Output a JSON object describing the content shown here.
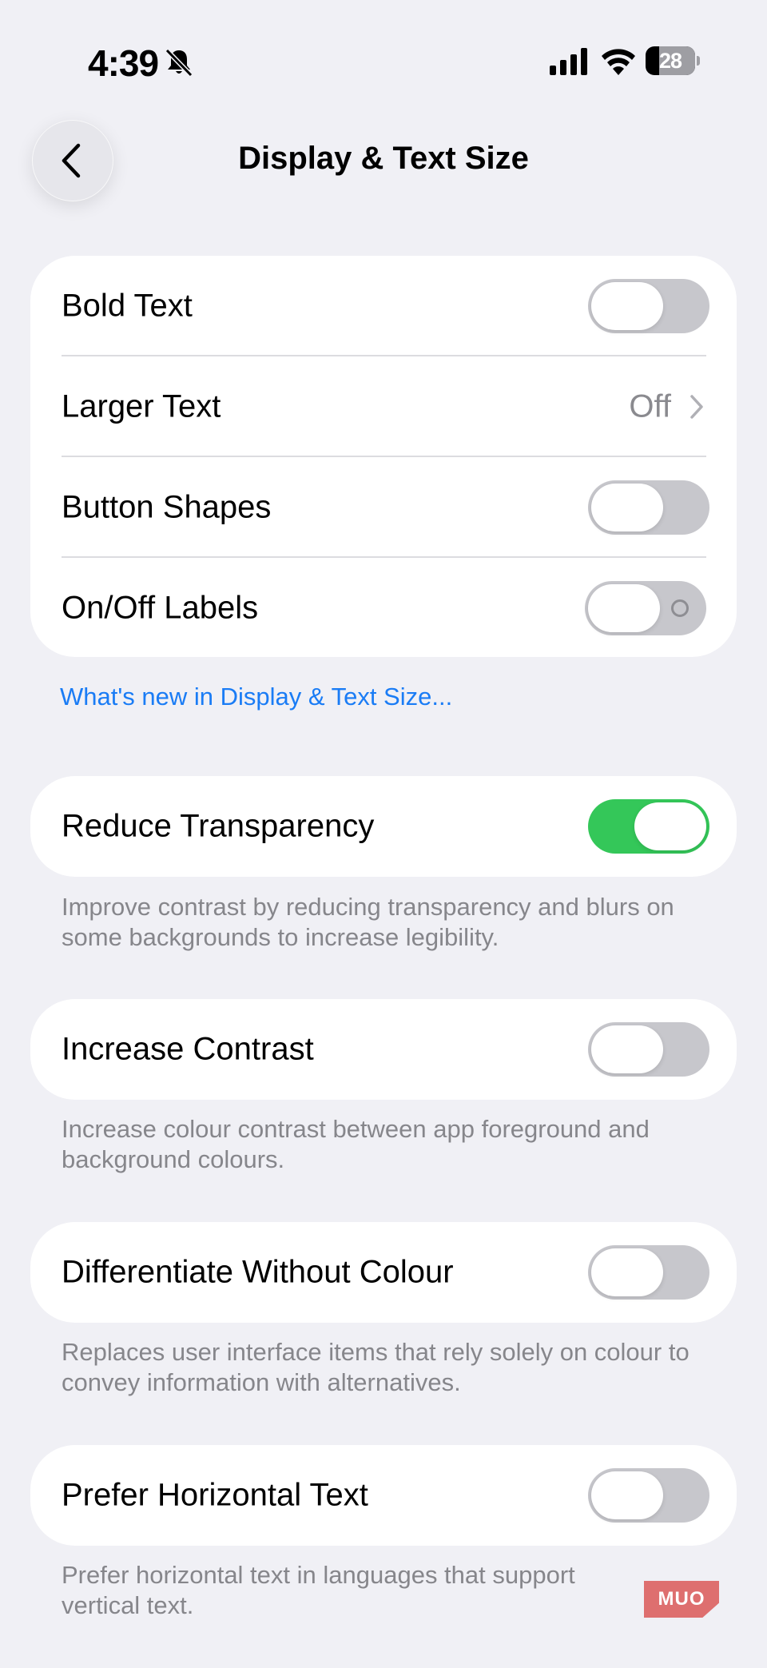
{
  "status_bar": {
    "time": "4:39",
    "battery": "28",
    "icons": [
      "bell-slash-icon",
      "cellular-signal-icon",
      "wifi-icon",
      "battery-icon"
    ]
  },
  "nav": {
    "title": "Display & Text Size",
    "back_icon": "chevron-left-icon"
  },
  "group1": {
    "bold_text": {
      "label": "Bold Text",
      "on": false
    },
    "larger_text": {
      "label": "Larger Text",
      "value": "Off"
    },
    "button_shapes": {
      "label": "Button Shapes",
      "on": false
    },
    "onoff_labels": {
      "label": "On/Off Labels",
      "on": false
    }
  },
  "whats_new_link": "What's new in Display & Text Size...",
  "reduce_transparency": {
    "label": "Reduce Transparency",
    "on": true,
    "footer": "Improve contrast by reducing transparency and blurs on some backgrounds to increase legibility."
  },
  "increase_contrast": {
    "label": "Increase Contrast",
    "on": false,
    "footer": "Increase colour contrast between app foreground and background colours."
  },
  "differentiate": {
    "label": "Differentiate Without Colour",
    "on": false,
    "footer": "Replaces user interface items that rely solely on colour to convey information with alternatives."
  },
  "horizontal_text": {
    "label": "Prefer Horizontal Text",
    "on": false,
    "footer": "Prefer horizontal text in languages that support vertical text."
  },
  "watermark": "MUO",
  "colors": {
    "background": "#f0f0f5",
    "toggle_on": "#34c759",
    "toggle_off": "#c7c7cc",
    "link": "#1a7cf5",
    "secondary_text": "#86868b"
  }
}
